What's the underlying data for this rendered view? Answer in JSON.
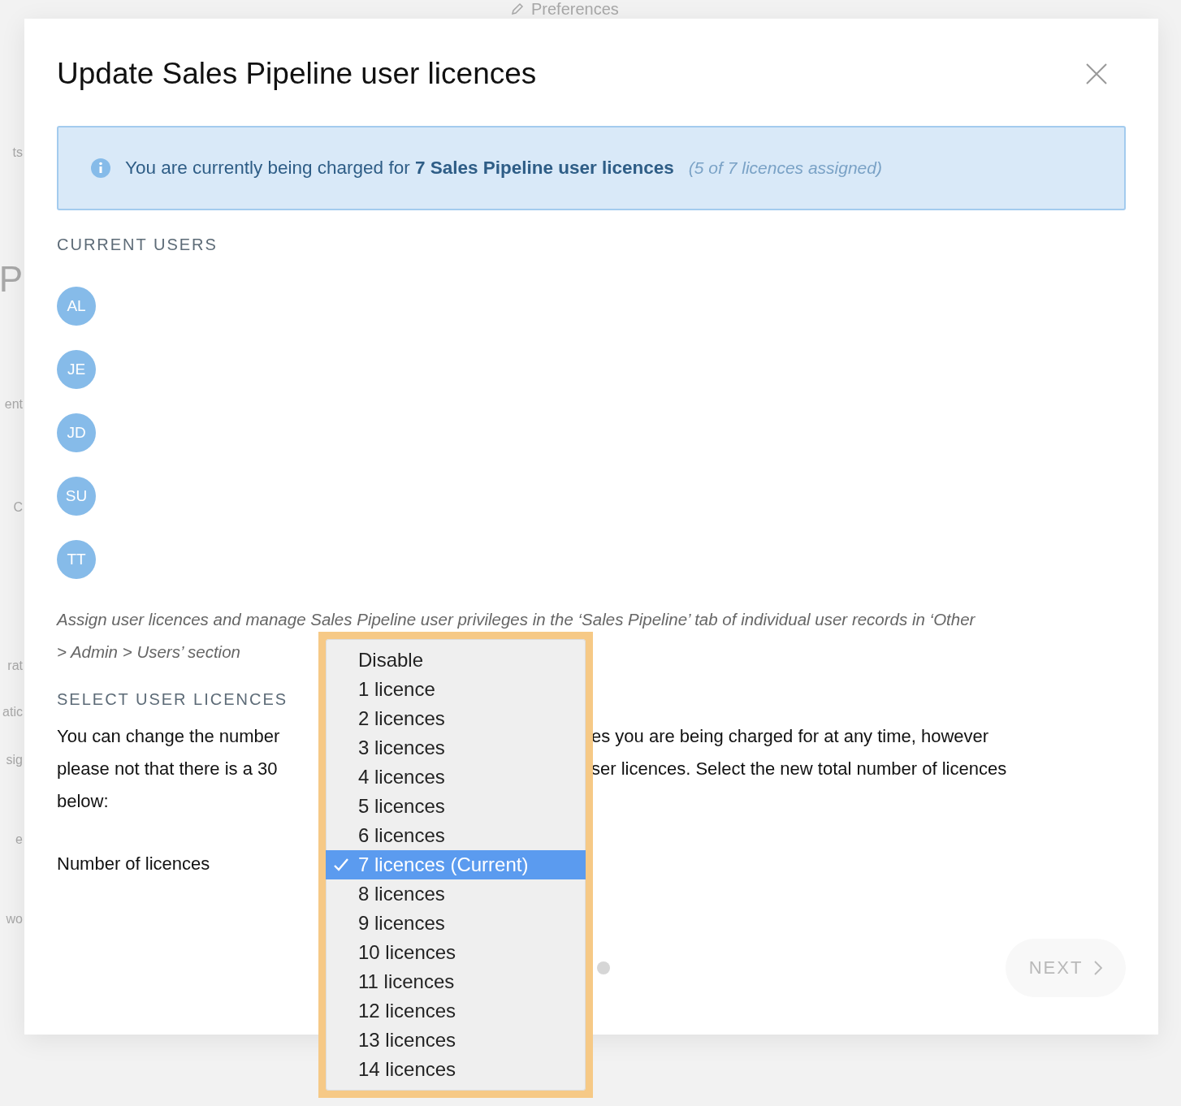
{
  "background": {
    "header": "Preferences",
    "fragments": [
      "ts",
      "P",
      "ent",
      "C",
      "rat",
      "atic",
      "sig",
      "e",
      "wo"
    ]
  },
  "dialog": {
    "title": "Update Sales Pipeline user licences",
    "notice": {
      "text": "You are currently being charged for **7 Sales Pipeline user licences**",
      "note": "(5 of 7 licences assigned)"
    },
    "current_users": {
      "heading": "CURRENT USERS",
      "users": [
        "AL",
        "JE",
        "JD",
        "SU",
        "TT"
      ]
    },
    "hint": [
      "Assign user licences and manage Sales Pipeline user privileges in the ‘Sales Pipeline’ tab of individual user records in ‘Other",
      "> Admin > Users’ section"
    ],
    "select_section": {
      "heading": "SELECT USER LICENCES",
      "lines": [
        {
          "left": "You can change the number",
          "right": "es you are being charged for at any time, however"
        },
        {
          "left": "please not that there is a 30",
          "right": "ser licences. Select the new total number of licences"
        },
        {
          "left": "below:"
        }
      ]
    },
    "field_label": "Number of licences",
    "next_button": "NEXT"
  },
  "dropdown": {
    "options": [
      {
        "label": "Disable",
        "selected": false
      },
      {
        "label": "1 licence",
        "selected": false
      },
      {
        "label": "2 licences",
        "selected": false
      },
      {
        "label": "3 licences",
        "selected": false
      },
      {
        "label": "4 licences",
        "selected": false
      },
      {
        "label": "5 licences",
        "selected": false
      },
      {
        "label": "6 licences",
        "selected": false
      },
      {
        "label": "7 licences (Current)",
        "selected": true
      },
      {
        "label": "8 licences",
        "selected": false
      },
      {
        "label": "9 licences",
        "selected": false
      },
      {
        "label": "10 licences",
        "selected": false
      },
      {
        "label": "11 licences",
        "selected": false
      },
      {
        "label": "12 licences",
        "selected": false
      },
      {
        "label": "13 licences",
        "selected": false
      },
      {
        "label": "14 licences",
        "selected": false
      }
    ]
  }
}
